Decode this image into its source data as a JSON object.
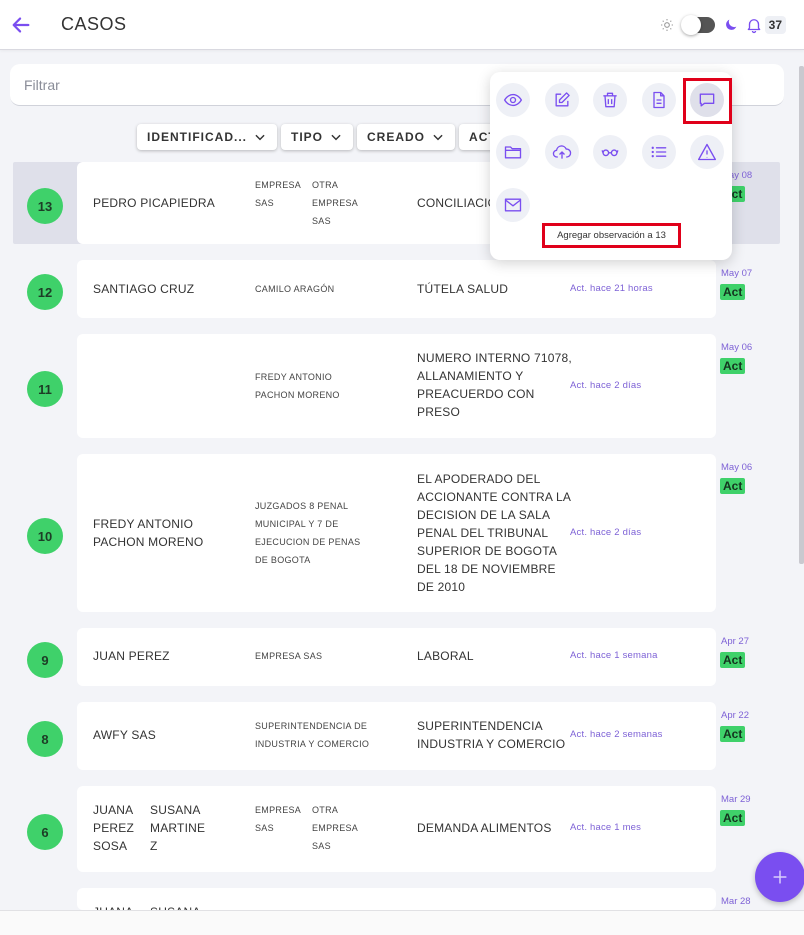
{
  "header": {
    "title": "CASOS",
    "notifications": "37"
  },
  "filter": {
    "placeholder": "Filtrar"
  },
  "sort": [
    "IDENTIFICAD...",
    "TIPO",
    "CREADO",
    "ACTUA"
  ],
  "popover": {
    "tooltip": "Agregar observación a 13"
  },
  "rows": [
    {
      "num": "13",
      "name": [
        "PEDRO PICAPIEDRA"
      ],
      "party_a": [
        "EMPRESA",
        "SAS"
      ],
      "party_b": [
        "OTRA",
        "EMPRESA",
        "SAS"
      ],
      "desc": [
        "CONCILIACIÓ"
      ],
      "act": "",
      "date": "May 08",
      "status": "Act"
    },
    {
      "num": "12",
      "name": [
        "SANTIAGO CRUZ"
      ],
      "party": [
        "CAMILO ARAGÓN"
      ],
      "desc": [
        "TÚTELA SALUD"
      ],
      "act": "Act. hace 21 horas",
      "date": "May 07",
      "status": "Act"
    },
    {
      "num": "11",
      "name": [],
      "party": [
        "FREDY ANTONIO",
        "PACHON MORENO"
      ],
      "desc": [
        "NUMERO INTERNO 71078,",
        "ALLANAMIENTO Y",
        "PREACUERDO CON",
        "PRESO"
      ],
      "act": "Act. hace 2 días",
      "date": "May 06",
      "status": "Act"
    },
    {
      "num": "10",
      "name": [
        "FREDY ANTONIO",
        "PACHON MORENO"
      ],
      "party": [
        "JUZGADOS 8 PENAL",
        "MUNICIPAL Y 7 DE",
        "EJECUCION DE PENAS",
        "DE BOGOTA"
      ],
      "desc": [
        "EL APODERADO DEL",
        "ACCIONANTE CONTRA LA",
        "DECISION DE LA SALA",
        "PENAL DEL TRIBUNAL",
        "SUPERIOR DE BOGOTA",
        "DEL 18 DE NOVIEMBRE",
        "DE 2010"
      ],
      "act": "Act. hace 2 días",
      "date": "May 06",
      "status": "Act"
    },
    {
      "num": "9",
      "name": [
        "JUAN PEREZ"
      ],
      "party": [
        "EMPRESA SAS"
      ],
      "desc": [
        "LABORAL"
      ],
      "act": "Act. hace 1 semana",
      "date": "Apr 27",
      "status": "Act"
    },
    {
      "num": "8",
      "name": [
        "AWFY SAS"
      ],
      "party": [
        "SUPERINTENDENCIA DE",
        "INDUSTRIA Y COMERCIO"
      ],
      "desc": [
        "SUPERINTENDENCIA",
        "INDUSTRIA Y COMERCIO"
      ],
      "act": "Act. hace 2 semanas",
      "date": "Apr 22",
      "status": "Act"
    },
    {
      "num": "6",
      "name_a": [
        "JUANA",
        "PEREZ",
        "SOSA"
      ],
      "name_b": [
        "SUSANA",
        "MARTINE",
        "Z"
      ],
      "party_a": [
        "EMPRESA",
        "SAS"
      ],
      "party_b": [
        "OTRA",
        "EMPRESA",
        "SAS"
      ],
      "desc": [
        "DEMANDA ALIMENTOS"
      ],
      "act": "Act. hace 1 mes",
      "date": "Mar 29",
      "status": "Act"
    },
    {
      "num": "",
      "name_a": [
        "JUANA"
      ],
      "name_b": [
        "SUSANA"
      ],
      "date": "Mar 28"
    }
  ],
  "colors": {
    "accent": "#7a4ef0",
    "status": "#3fd16a",
    "highlight": "#e0001a"
  },
  "icons": [
    "back-arrow-icon",
    "sun-icon",
    "moon-icon",
    "bell-icon",
    "eye-icon",
    "edit-icon",
    "trash-icon",
    "document-icon",
    "comment-icon",
    "folder-icon",
    "upload-cloud-icon",
    "glasses-icon",
    "list-icon",
    "warning-icon",
    "mail-icon",
    "plus-icon",
    "chevron-down-icon"
  ]
}
